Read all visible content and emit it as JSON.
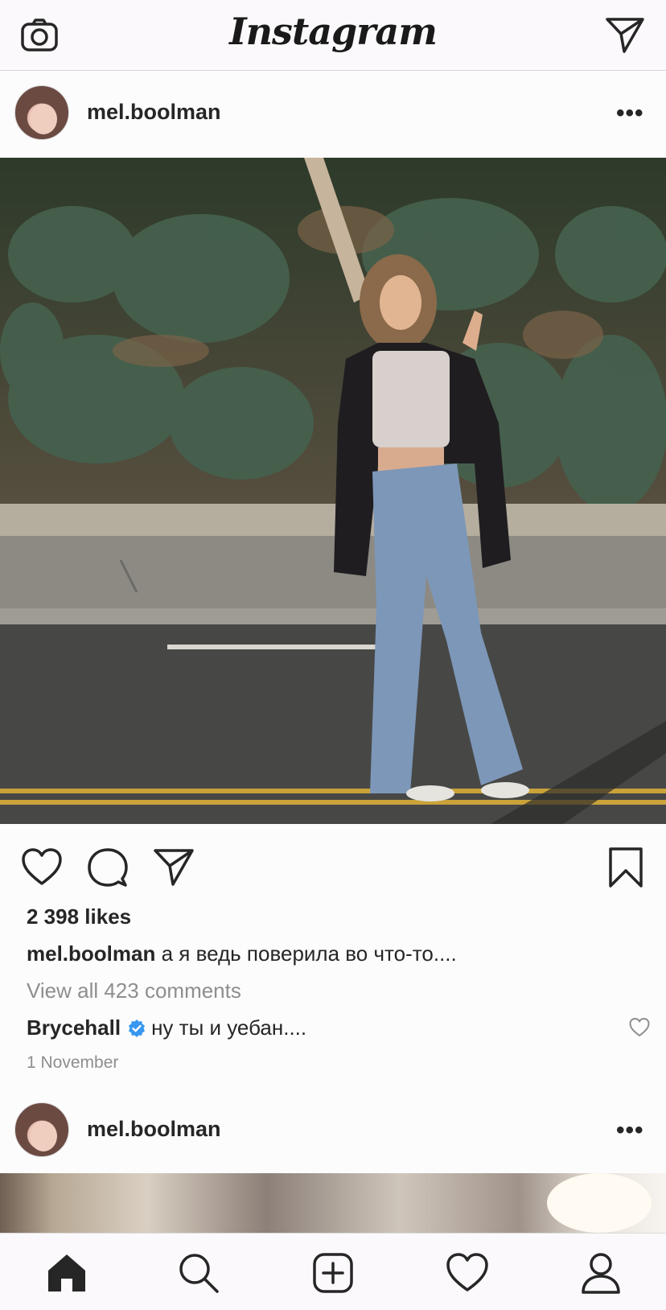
{
  "app": {
    "title": "Instagram"
  },
  "topbar": {
    "camera_icon": "camera-icon",
    "direct_icon": "paper-plane-icon"
  },
  "post1": {
    "username": "mel.boolman",
    "more_icon": "•••",
    "likes": "2 398 likes",
    "caption_user": "mel.boolman",
    "caption_text": "а я ведь поверила во что-то....",
    "view_all": "View all 423 comments",
    "comment_user": "Brycehall",
    "comment_text": "ну ты и уебан....",
    "timestamp": "1 November"
  },
  "post2": {
    "username": "mel.boolman",
    "more_icon": "•••"
  },
  "tabbar": {
    "items": [
      "home-icon",
      "search-icon",
      "new-post-icon",
      "activity-heart-icon",
      "profile-icon"
    ]
  },
  "colors": {
    "text": "#262626",
    "muted": "#8e8e8e",
    "verified": "#3897f0",
    "bar_bg": "#fbf9fb"
  }
}
